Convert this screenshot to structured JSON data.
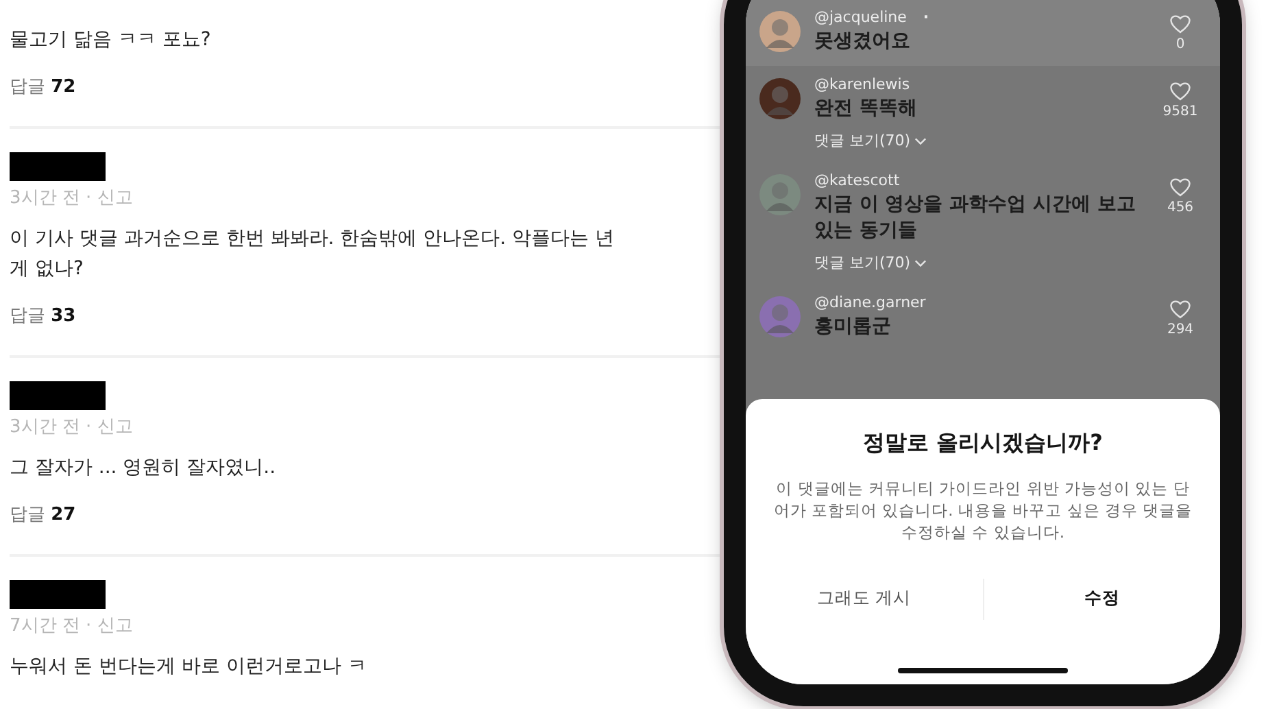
{
  "article_comments": [
    {
      "redacted": false,
      "text_lines": [
        "물고기 닮음 ㅋㅋ 포뇨?"
      ],
      "replies": "답글 **72**"
    },
    {
      "redacted": true,
      "meta": "3시간 전 · 신고",
      "text_lines": [
        "이 기사 댓글 과거순으로 한번 봐봐라. 한숨밖에 안나온다. 악플다는 년",
        "게 없나?"
      ],
      "replies": "답글 **33**"
    },
    {
      "redacted": true,
      "meta": "3시간 전 · 신고",
      "text_lines": [
        "그 잘자가 ... 영원히 잘자였니.."
      ],
      "replies": "답글 **27**"
    },
    {
      "redacted": true,
      "meta": "7시간 전 · 신고",
      "text_lines": [
        "누워서 돈 번다는게 바로 이런거로고나 ㅋ"
      ]
    }
  ],
  "phone": {
    "comments": [
      {
        "handle": "@jacqueline",
        "dot": "·",
        "text": "못생겼어요",
        "likes": "0",
        "highlighted": true
      },
      {
        "handle": "@karenlewis",
        "text": "완전 똑똑해",
        "likes": "9581",
        "view_replies": "댓글 보기(70)",
        "highlighted": false
      },
      {
        "handle": "@katescott",
        "text": "지금 이 영상을 과학수업 시간에 보고 있는 동기들",
        "likes": "456",
        "view_replies": "댓글 보기(70)",
        "highlighted": false
      },
      {
        "handle": "@diane.garner",
        "text": "홍미롭군",
        "likes": "294",
        "highlighted": false
      }
    ],
    "dialog": {
      "title": "정말로 올리시겠습니까?",
      "message": "이 댓글에는 커뮤니티 가이드라인 위반 가능성이 있는 단어가 포함되어 있습니다. 내용을 바꾸고 싶은 경우 댓글을 수정하실 수 있습니다.",
      "buttons": [
        {
          "label": "그래도 게시",
          "primary": false
        },
        {
          "label": "수정",
          "primary": true
        }
      ]
    }
  }
}
